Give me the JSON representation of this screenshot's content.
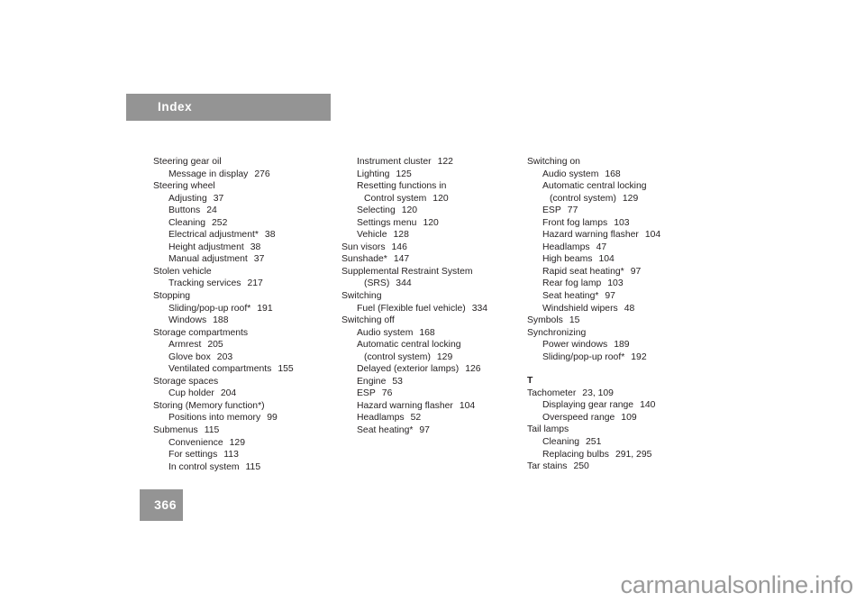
{
  "header": {
    "title": "Index"
  },
  "footer": {
    "page_number": "366",
    "watermark": "carmanualsonline.info"
  },
  "colors": {
    "bar_gray": "#949494",
    "text": "#231f20",
    "watermark_gray": "#9a9a9a"
  },
  "columns": [
    {
      "id": "column-1",
      "entries": [
        {
          "level": 0,
          "text": "Steering gear oil",
          "page": ""
        },
        {
          "level": 1,
          "text": "Message in display",
          "page": "276"
        },
        {
          "level": 0,
          "text": "Steering wheel",
          "page": ""
        },
        {
          "level": 1,
          "text": "Adjusting",
          "page": "37"
        },
        {
          "level": 1,
          "text": "Buttons",
          "page": "24"
        },
        {
          "level": 1,
          "text": "Cleaning",
          "page": "252"
        },
        {
          "level": 1,
          "text": "Electrical adjustment*",
          "page": "38"
        },
        {
          "level": 1,
          "text": "Height adjustment",
          "page": "38"
        },
        {
          "level": 1,
          "text": "Manual adjustment",
          "page": "37"
        },
        {
          "level": 0,
          "text": "Stolen vehicle",
          "page": ""
        },
        {
          "level": 1,
          "text": "Tracking services",
          "page": "217"
        },
        {
          "level": 0,
          "text": "Stopping",
          "page": ""
        },
        {
          "level": 1,
          "text": "Sliding/pop-up roof*",
          "page": "191"
        },
        {
          "level": 1,
          "text": "Windows",
          "page": "188"
        },
        {
          "level": 0,
          "text": "Storage compartments",
          "page": ""
        },
        {
          "level": 1,
          "text": "Armrest",
          "page": "205"
        },
        {
          "level": 1,
          "text": "Glove box",
          "page": "203"
        },
        {
          "level": 1,
          "text": "Ventilated compartments",
          "page": "155"
        },
        {
          "level": 0,
          "text": "Storage spaces",
          "page": ""
        },
        {
          "level": 1,
          "text": "Cup holder",
          "page": "204"
        },
        {
          "level": 0,
          "text": "Storing (Memory function*)",
          "page": ""
        },
        {
          "level": 1,
          "text": "Positions into memory",
          "page": "99"
        },
        {
          "level": 0,
          "text": "Submenus",
          "page": "115"
        },
        {
          "level": 1,
          "text": "Convenience",
          "page": "129"
        },
        {
          "level": 1,
          "text": "For settings",
          "page": "113"
        },
        {
          "level": 1,
          "text": "In control system",
          "page": "115"
        }
      ]
    },
    {
      "id": "column-2",
      "entries": [
        {
          "level": 1,
          "text": "Instrument cluster",
          "page": "122"
        },
        {
          "level": 1,
          "text": "Lighting",
          "page": "125"
        },
        {
          "level": 1,
          "text": "Resetting functions in",
          "page": ""
        },
        {
          "level": 2,
          "text": "Control system",
          "page": "120"
        },
        {
          "level": 1,
          "text": "Selecting",
          "page": "120"
        },
        {
          "level": 1,
          "text": "Settings menu",
          "page": "120"
        },
        {
          "level": 1,
          "text": "Vehicle",
          "page": "128"
        },
        {
          "level": 0,
          "text": "Sun visors",
          "page": "146"
        },
        {
          "level": 0,
          "text": "Sunshade*",
          "page": "147"
        },
        {
          "level": 0,
          "text": "Supplemental Restraint System",
          "page": ""
        },
        {
          "level": 2,
          "text": "(SRS)",
          "page": "344"
        },
        {
          "level": 0,
          "text": "Switching",
          "page": ""
        },
        {
          "level": 1,
          "text": "Fuel (Flexible fuel vehicle)",
          "page": "334"
        },
        {
          "level": 0,
          "text": "Switching off",
          "page": ""
        },
        {
          "level": 1,
          "text": "Audio system",
          "page": "168"
        },
        {
          "level": 1,
          "text": "Automatic central locking",
          "page": ""
        },
        {
          "level": 2,
          "text": "(control system)",
          "page": "129"
        },
        {
          "level": 1,
          "text": "Delayed (exterior lamps)",
          "page": "126"
        },
        {
          "level": 1,
          "text": "Engine",
          "page": "53"
        },
        {
          "level": 1,
          "text": "ESP",
          "page": "76"
        },
        {
          "level": 1,
          "text": "Hazard warning flasher",
          "page": "104"
        },
        {
          "level": 1,
          "text": "Headlamps",
          "page": "52"
        },
        {
          "level": 1,
          "text": "Seat heating*",
          "page": "97"
        }
      ]
    },
    {
      "id": "column-3",
      "entries": [
        {
          "level": 0,
          "text": "Switching on",
          "page": ""
        },
        {
          "level": 1,
          "text": "Audio system",
          "page": "168"
        },
        {
          "level": 1,
          "text": "Automatic central locking",
          "page": ""
        },
        {
          "level": 2,
          "text": "(control system)",
          "page": "129"
        },
        {
          "level": 1,
          "text": "ESP",
          "page": "77"
        },
        {
          "level": 1,
          "text": "Front fog lamps",
          "page": "103"
        },
        {
          "level": 1,
          "text": "Hazard warning flasher",
          "page": "104"
        },
        {
          "level": 1,
          "text": "Headlamps",
          "page": "47"
        },
        {
          "level": 1,
          "text": "High beams",
          "page": "104"
        },
        {
          "level": 1,
          "text": "Rapid seat heating*",
          "page": "97"
        },
        {
          "level": 1,
          "text": "Rear fog lamp",
          "page": "103"
        },
        {
          "level": 1,
          "text": "Seat heating*",
          "page": "97"
        },
        {
          "level": 1,
          "text": "Windshield wipers",
          "page": "48"
        },
        {
          "level": 0,
          "text": "Symbols",
          "page": "15"
        },
        {
          "level": 0,
          "text": "Synchronizing",
          "page": ""
        },
        {
          "level": 1,
          "text": "Power windows",
          "page": "189"
        },
        {
          "level": 1,
          "text": "Sliding/pop-up roof*",
          "page": "192"
        },
        {
          "level": 0,
          "letter": "T"
        },
        {
          "level": 0,
          "text": "Tachometer",
          "page": "23, 109"
        },
        {
          "level": 1,
          "text": "Displaying gear range",
          "page": "140"
        },
        {
          "level": 1,
          "text": "Overspeed range",
          "page": "109"
        },
        {
          "level": 0,
          "text": "Tail lamps",
          "page": ""
        },
        {
          "level": 1,
          "text": "Cleaning",
          "page": "251"
        },
        {
          "level": 1,
          "text": "Replacing bulbs",
          "page": "291, 295"
        },
        {
          "level": 0,
          "text": "Tar stains",
          "page": "250"
        }
      ]
    }
  ]
}
